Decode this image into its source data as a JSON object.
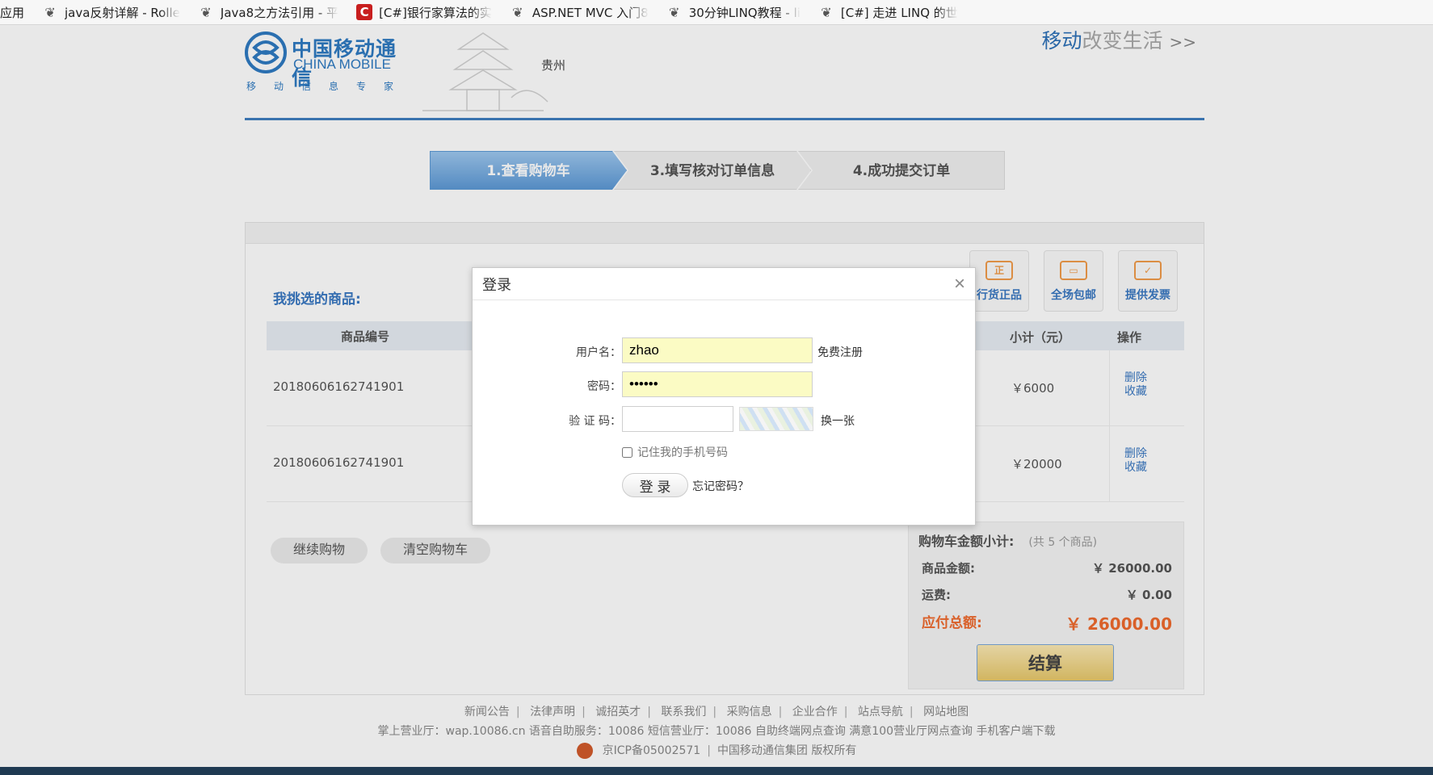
{
  "bookmarks": {
    "first_label": "应用",
    "items": [
      {
        "label": "java反射详解 - Rolle",
        "icon": "leaf-icon"
      },
      {
        "label": "Java8之方法引用 - 平",
        "icon": "leaf-icon"
      },
      {
        "label": "[C#]银行家算法的实",
        "icon": "c-logo-icon"
      },
      {
        "label": "ASP.NET MVC 入门8",
        "icon": "leaf-icon"
      },
      {
        "label": "30分钟LINQ教程 - li",
        "icon": "leaf-icon"
      },
      {
        "label": "[C#] 走进 LINQ 的世",
        "icon": "leaf-icon"
      }
    ]
  },
  "header": {
    "logo_cn": "中国移动通信",
    "logo_en": "CHINA MOBILE",
    "logo_slogan": "移动信息专家",
    "city": "贵州",
    "tagline_part1": "移动",
    "tagline_part2": "改变生活",
    "tagline_part3": ">>"
  },
  "steps": [
    "1.查看购物车",
    "3.填写核对订单信息",
    "4.成功提交订单"
  ],
  "cart": {
    "section_title": "我挑选的商品:",
    "badges": [
      "行货正品",
      "全场包邮",
      "提供发票"
    ],
    "columns": {
      "code": "商品编号",
      "subtotal": "小计（元）",
      "operation": "操作"
    },
    "rows": [
      {
        "code": "20180606162741901",
        "subtotal": "￥6000",
        "delete": "删除",
        "favorite": "收藏"
      },
      {
        "code": "20180606162741901",
        "subtotal": "￥20000",
        "delete": "删除",
        "favorite": "收藏"
      }
    ],
    "continue_label": "继续购物",
    "clear_label": "清空购物车"
  },
  "summary": {
    "title": "购物车金额小计:",
    "count": "(共 5 个商品)",
    "goods_label": "商品金额:",
    "goods_value": "￥ 26000.00",
    "shipping_label": "运费:",
    "shipping_value": "￥ 0.00",
    "total_label": "应付总额:",
    "total_value": "￥ 26000.00",
    "checkout_label": "结算"
  },
  "footer": {
    "links": [
      "新闻公告",
      "法律声明",
      "诚招英才",
      "联系我们",
      "采购信息",
      "企业合作",
      "站点导航",
      "网站地图"
    ],
    "service_line": "掌上营业厅：wap.10086.cn  语音自助服务：10086  短信营业厅：10086  自助终端网点查询  满意100营业厅网点查询  手机客户端下载",
    "icp": "京ICP备05002571",
    "copyright": "中国移动通信集团 版权所有"
  },
  "login_modal": {
    "title": "登录",
    "username_label": "用户名：",
    "username_value": "zhao",
    "register_link": "免费注册",
    "password_label": "密码：",
    "password_value": "••••••",
    "captcha_label": "验 证 码：",
    "captcha_value": "",
    "captcha_refresh": "换一张",
    "remember_label": "记住我的手机号码",
    "login_button": "登 录",
    "forgot_link": "忘记密码？"
  },
  "colors": {
    "brand_blue": "#2f7bc2",
    "accent_orange": "#ef6a2e"
  }
}
